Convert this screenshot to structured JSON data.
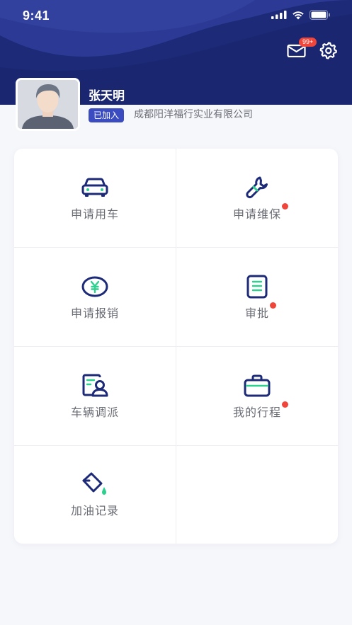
{
  "status_bar": {
    "time": "9:41"
  },
  "header": {
    "mail_badge": "99+",
    "colors": {
      "primary": "#1d2a78",
      "accent": "#2fcf8f",
      "badge": "#f0453a"
    }
  },
  "profile": {
    "name": "张天明",
    "tag": "已加入",
    "company": "成都阳洋福行实业有限公司"
  },
  "menu": [
    {
      "label": "申请用车",
      "icon": "car-icon",
      "dot": false
    },
    {
      "label": "申请维保",
      "icon": "wrench-icon",
      "dot": true
    },
    {
      "label": "申请报销",
      "icon": "yen-coin-icon",
      "dot": false
    },
    {
      "label": "审批",
      "icon": "document-icon",
      "dot": true
    },
    {
      "label": "车辆调派",
      "icon": "driver-card-icon",
      "dot": false
    },
    {
      "label": "我的行程",
      "icon": "briefcase-icon",
      "dot": true
    },
    {
      "label": "加油记录",
      "icon": "fuel-bucket-icon",
      "dot": false
    }
  ]
}
